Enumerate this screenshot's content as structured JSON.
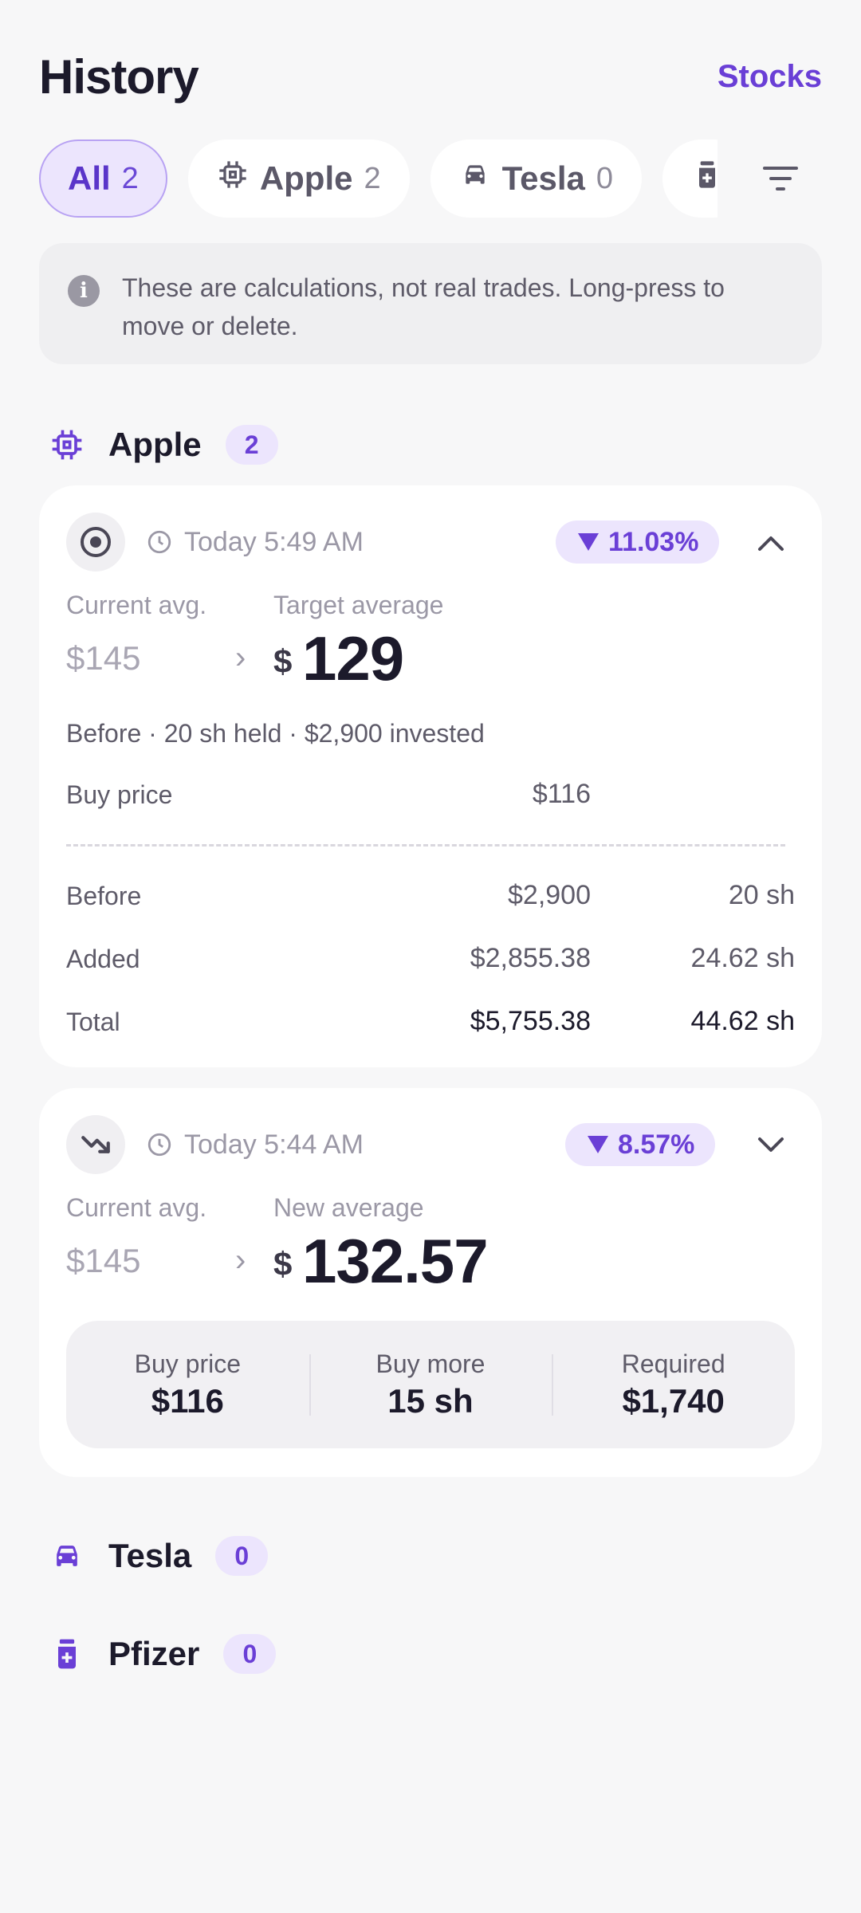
{
  "header": {
    "title": "History",
    "link": "Stocks"
  },
  "chips": [
    {
      "label": "All",
      "count": "2",
      "icon": "all"
    },
    {
      "label": "Apple",
      "count": "2",
      "icon": "chip-icon"
    },
    {
      "label": "Tesla",
      "count": "0",
      "icon": "car-icon"
    },
    {
      "label": "",
      "count": "",
      "icon": "medicine-icon"
    }
  ],
  "info": {
    "text": "These are calculations, not real trades. Long-press to move or delete."
  },
  "groups": {
    "apple": {
      "name": "Apple",
      "count": "2"
    },
    "tesla": {
      "name": "Tesla",
      "count": "0"
    },
    "pfizer": {
      "name": "Pfizer",
      "count": "0"
    }
  },
  "card1": {
    "time": "Today 5:49 AM",
    "badge": "11.03%",
    "current_label": "Current avg.",
    "current_value": "$145",
    "arrow": "›",
    "target_label": "Target average",
    "currency": "$",
    "target_value": "129",
    "summary_line": "Before · 20 sh held · $2,900 invested",
    "buy_price_label": "Buy price",
    "buy_price_value": "$116",
    "rows": [
      {
        "label": "Before",
        "amount": "$2,900",
        "shares": "20 sh"
      },
      {
        "label": "Added",
        "amount": "$2,855.38",
        "shares": "24.62 sh"
      },
      {
        "label": "Total",
        "amount": "$5,755.38",
        "shares": "44.62 sh"
      }
    ]
  },
  "card2": {
    "time": "Today 5:44 AM",
    "badge": "8.57%",
    "current_label": "Current avg.",
    "current_value": "$145",
    "arrow": "›",
    "new_label": "New average",
    "currency": "$",
    "new_value": "132.57",
    "summary": [
      {
        "label": "Buy price",
        "value": "$116"
      },
      {
        "label": "Buy more",
        "value": "15 sh"
      },
      {
        "label": "Required",
        "value": "$1,740"
      }
    ]
  },
  "colors": {
    "accent": "#6a3fd6",
    "accent_soft": "#ece5fd",
    "background": "#f7f7f8"
  }
}
